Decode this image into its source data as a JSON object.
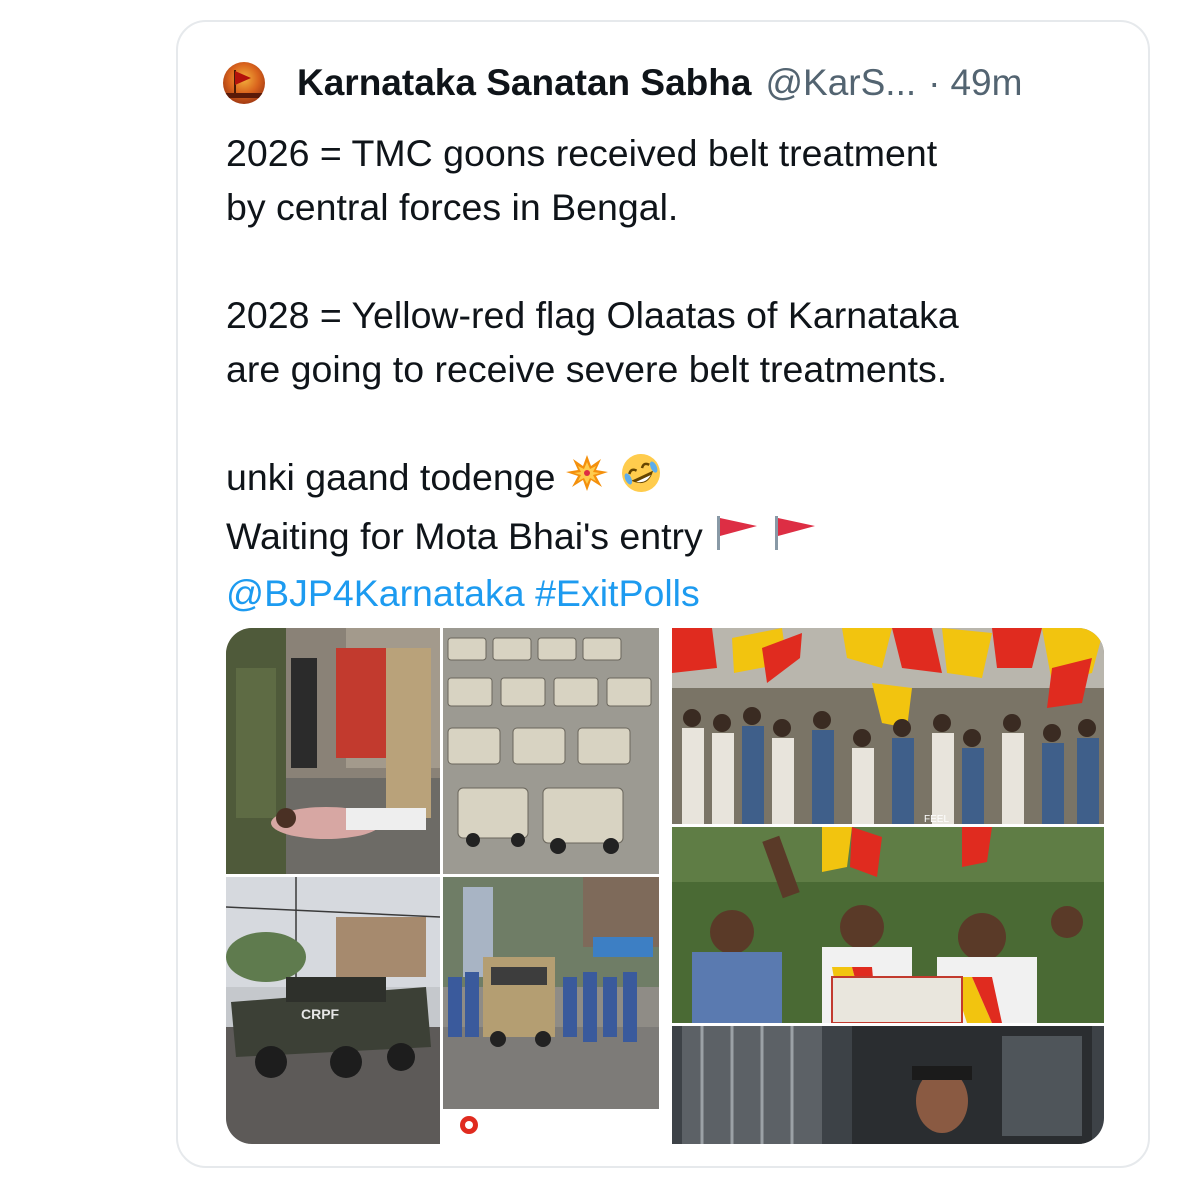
{
  "tweet": {
    "author_name": "Karnataka Sanatan Sabha",
    "handle": "@KarS...",
    "separator": "·",
    "time": "49m",
    "line1": "2026 = TMC goons received belt treatment",
    "line2": "by central forces in Bengal.",
    "line3": "2028 = Yellow-red flag Olaatas of Karnataka",
    "line4": "are going to receive severe belt treatments.",
    "line5": "unki gaand todenge",
    "line6": "Waiting for Mota Bhai's entry",
    "mention": "@BJP4Karnataka",
    "hashtag": "#ExitPolls",
    "emojis": [
      "collision-emoji",
      "rofl-emoji",
      "red-flag-emoji",
      "red-flag-emoji"
    ]
  },
  "media": {
    "tile_vehicle_label": "CRPF",
    "banner_text": "FEEL"
  },
  "colors": {
    "text": "#0f1419",
    "secondary": "#536471",
    "link": "#1d9bf0",
    "border": "#e6e9ec"
  }
}
